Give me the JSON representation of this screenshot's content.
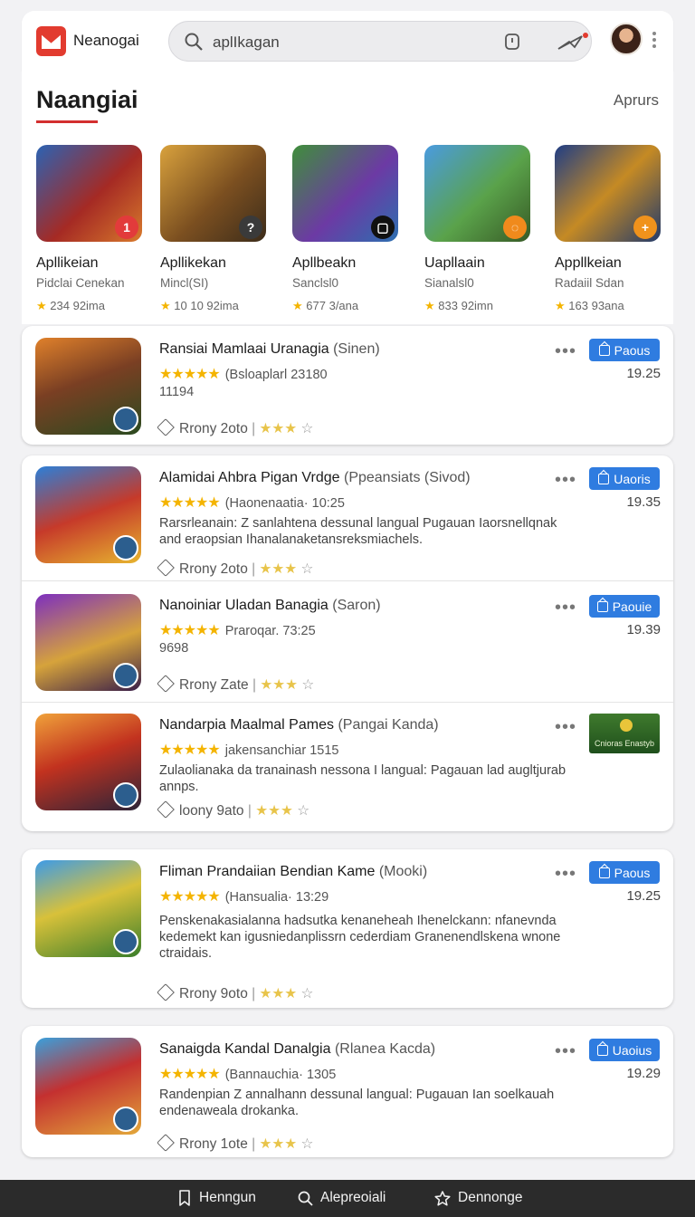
{
  "topbar": {
    "brand": "Neanogai",
    "search_placeholder": "aplIkagan"
  },
  "featured": {
    "title": "Naangiai",
    "link": "Aprurs",
    "apps": [
      {
        "name": "Apllikeian",
        "dev": "Pidclai Cenekan",
        "rating": "234 92ima",
        "badge": "1",
        "badge_color": "#e23b3b",
        "grad": "linear-gradient(135deg,#2b63b4,#a52a24 55%,#d87a2c)"
      },
      {
        "name": "Apllikekan",
        "dev": "Mincl(SI)",
        "rating": "10 10 92ima",
        "badge": "?",
        "badge_color": "#3a3a3a",
        "grad": "linear-gradient(135deg,#d9a23d,#7b4f20 55%,#3c2c1a)"
      },
      {
        "name": "Apllbeakn",
        "dev": "Sanclsl0",
        "rating": "677 3/ana",
        "badge": "▢",
        "badge_color": "#111111",
        "grad": "linear-gradient(135deg,#3f8f3a,#6c3aa4 55%,#2c6fb0)"
      },
      {
        "name": "Uapllaain",
        "dev": "Sianalsl0",
        "rating": "833 92imn",
        "badge": "◌",
        "badge_color": "#f08a1c",
        "grad": "linear-gradient(135deg,#4a9be0,#5aa24a 55%,#375a26)"
      },
      {
        "name": "Appllkeian",
        "dev": "Radaiil Sdan",
        "rating": "163 93ana",
        "badge": "+",
        "badge_color": "#f0921c",
        "grad": "linear-gradient(135deg,#1f3d85,#c58a24 50%,#223a6b)"
      }
    ]
  },
  "list": [
    {
      "title": "Ransiai Mamlaai Uranagia",
      "sub": "(Sinen)",
      "rating_text": "(Bsloaplarl 23180",
      "extra": "11194",
      "desc": "",
      "footer": "Rrony 2oto",
      "action": "Paous",
      "time": "19.25",
      "grad": "linear-gradient(160deg,#e0812b,#7a3f23 45%,#2b4a1f)"
    },
    {
      "title": "Alamidai  Ahbra Pigan Vrdge",
      "sub": "(Ppeansiats (Sivod)",
      "rating_text": "(Haonenaatia·    10:25",
      "extra": "",
      "desc": "Rarsrleanain: Z sanlahtena dessunal langual Pugauan Iaorsnellqnak and eraopsian Ihanalanaketansreksmiachels.",
      "footer": "Rrony 2oto",
      "action": "Uaoris",
      "time": "19.35",
      "grad": "linear-gradient(160deg,#2c7fd8,#c63a2a 50%,#e7b52f)"
    },
    {
      "title": "Nanoiniar Uladan Banagia",
      "sub": "(Saron)",
      "rating_text": "Praroqar.  73:25",
      "extra": "9698",
      "desc": "",
      "footer": "Rrony Zate",
      "action": "Paouie",
      "time": "19.39",
      "grad": "linear-gradient(160deg,#7d2fbf,#d6a33b 55%,#3a1f4a)"
    },
    {
      "title": "Nandarpia  Maalmal Pames",
      "sub": "(Pangai Kanda)",
      "rating_text": "jakensanchiar      1515",
      "extra": "",
      "desc": "Zulaolianaka da tranainash nessona I langual: Pagauan lad augltjurab annps.",
      "footer": "loony 9ato",
      "action": "",
      "time": "",
      "grad": "linear-gradient(160deg,#f0a23a,#c2321f 45%,#2d2438)"
    },
    {
      "title": "Fliman Prandaiian  Bendian Kame",
      "sub": "(Mooki)",
      "rating_text": "(Hansualia·     13:29",
      "extra": "",
      "desc": "Penskenakasialanna hadsutka kenaneheah Ihenelckann: nfanevnda kedemekt kan igusniedanplissrn cederdiam Granenendlskena wnone ctraidais.",
      "footer": "Rrony 9oto",
      "action": "Paous",
      "time": "19.25",
      "grad": "linear-gradient(160deg,#3d9be8,#d8c13a 45%,#3a7e2a)"
    },
    {
      "title": "Sanaigda  Kandal Danalgia",
      "sub": "(Rlanea Kacda)",
      "rating_text": "(Bannauchia·     1305",
      "extra": "",
      "desc": "Randenpian  Z annalhann dessunal langual: Pugauan Ian soelkauah endenaweala drokanka.",
      "footer": "Rrony 1ote",
      "action": "Uaoius",
      "time": "19.29",
      "grad": "linear-gradient(160deg,#3aa0dc,#c43030 45%,#e3a83a)"
    }
  ],
  "promo_text": "Cnioras Enastyb",
  "bottom_nav": [
    {
      "label": "Henngun",
      "icon": "bookmark-icon"
    },
    {
      "label": "Alepreoiali",
      "icon": "search-icon"
    },
    {
      "label": "Dennonge",
      "icon": "star-icon"
    }
  ]
}
